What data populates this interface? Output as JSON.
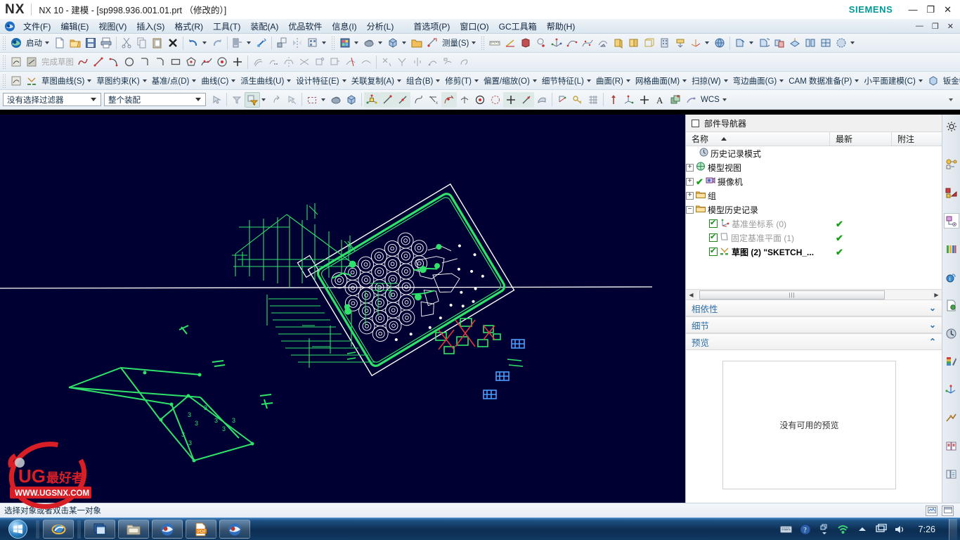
{
  "window": {
    "logo": "NX",
    "title": "NX 10 - 建模 - [sp998.936.001.01.prt （修改的）]",
    "brand": "SIEMENS",
    "minimize": "—",
    "restore": "❐",
    "close": "✕"
  },
  "menubar": {
    "items": [
      {
        "label": "文件(F)",
        "name": "menu-file"
      },
      {
        "label": "编辑(E)",
        "name": "menu-edit"
      },
      {
        "label": "视图(V)",
        "name": "menu-view"
      },
      {
        "label": "插入(S)",
        "name": "menu-insert"
      },
      {
        "label": "格式(R)",
        "name": "menu-format"
      },
      {
        "label": "工具(T)",
        "name": "menu-tools"
      },
      {
        "label": "装配(A)",
        "name": "menu-assemblies"
      },
      {
        "label": "优品软件",
        "name": "menu-youpin"
      },
      {
        "label": "信息(I)",
        "name": "menu-information"
      },
      {
        "label": "分析(L)",
        "name": "menu-analysis"
      },
      {
        "label": "首选项(P)",
        "name": "menu-preferences"
      },
      {
        "label": "窗口(O)",
        "name": "menu-window"
      },
      {
        "label": "GC工具箱",
        "name": "menu-gc-toolkits"
      },
      {
        "label": "帮助(H)",
        "name": "menu-help"
      }
    ]
  },
  "toolbar_standard": {
    "start_label": "启动",
    "measure_label": "测量(S)",
    "buttons": [
      "new-icon",
      "open-icon",
      "save-icon",
      "print-icon",
      "cut-icon",
      "copy-icon",
      "paste-icon",
      "delete-icon",
      "undo-icon",
      "redo-icon",
      "model-tree-icon",
      "link-icon",
      "transform-icon",
      "mirror-icon",
      "pattern-icon"
    ]
  },
  "toolbar_sketch": {
    "finish_sketch_label": "完成草图",
    "tools": [
      "sketch-in-task-icon",
      "sketch-on-plane-icon",
      "profile-icon",
      "line-icon",
      "arc-icon",
      "circle-icon",
      "fillet-icon",
      "chamfer-icon",
      "rectangle-icon",
      "polygon-icon",
      "studio-spline-icon",
      "ellipse-icon",
      "point-icon",
      "offset-curve-icon",
      "pattern-curve-icon",
      "mirror-curve-icon",
      "intersection-point-icon",
      "derived-lines-icon",
      "project-curve-icon",
      "quick-trim-icon",
      "quick-extend-icon",
      "constraint-icon",
      "auto-dimension-icon",
      "make-symmetric-icon",
      "animate-dimension-icon",
      "display-constraints-icon",
      "relation-browser-icon"
    ]
  },
  "toolbar_feature": {
    "groups": [
      {
        "label": "草图曲线(S)",
        "name": "group-sketch-curve"
      },
      {
        "label": "草图约束(K)",
        "name": "group-sketch-constraint"
      },
      {
        "label": "基准/点(D)",
        "name": "group-datum-point"
      },
      {
        "label": "曲线(C)",
        "name": "group-curve"
      },
      {
        "label": "派生曲线(U)",
        "name": "group-derived-curve"
      },
      {
        "label": "设计特征(E)",
        "name": "group-design-feature"
      },
      {
        "label": "关联复制(A)",
        "name": "group-associative-copy"
      },
      {
        "label": "组合(B)",
        "name": "group-combine"
      },
      {
        "label": "修剪(T)",
        "name": "group-trim"
      },
      {
        "label": "偏置/缩放(O)",
        "name": "group-offset-scale"
      },
      {
        "label": "细节特征(L)",
        "name": "group-detail-feature"
      },
      {
        "label": "曲面(R)",
        "name": "group-surface"
      },
      {
        "label": "网格曲面(M)",
        "name": "group-mesh-surface"
      },
      {
        "label": "扫掠(W)",
        "name": "group-sweep"
      },
      {
        "label": "弯边曲面(G)",
        "name": "group-flange-surface"
      },
      {
        "label": "CAM 数据准备(P)",
        "name": "group-cam-data-prep"
      },
      {
        "label": "小平面建模(C)",
        "name": "group-facet-modeling"
      },
      {
        "label": "钣金特征(H)",
        "name": "group-sheet-metal-feature"
      }
    ],
    "overflow": "»"
  },
  "selection_bar": {
    "filter_value": "没有选择过滤器",
    "scope_value": "整个装配",
    "wcs_label": "WCS",
    "icons": [
      "select-general-icon",
      "filter-icon",
      "selection-priority-icon",
      "move-object-icon",
      "deselect-icon",
      "rectangle-select-icon",
      "shaded-icon",
      "box-icon",
      "datum-csys-icon",
      "line-icon",
      "arc-icon",
      "spline-icon",
      "dimension-icon",
      "curve-icon",
      "point-icon",
      "circle-center-icon",
      "quadrant-icon",
      "intersection-icon",
      "tangent-icon",
      "face-icon",
      "wcs-dynamics-icon",
      "key-icon",
      "grid-icon",
      "vector-icon",
      "csys-icon",
      "plus-icon",
      "text-icon",
      "layer-icon",
      "wcs-icon"
    ]
  },
  "navigator": {
    "panel_title": "部件导航器",
    "columns": {
      "name": "名称",
      "newest": "最新",
      "note": "附注"
    },
    "rows": [
      {
        "label": "历史记录模式",
        "icon": "clock-icon",
        "indent": 1,
        "expander": "",
        "check": false,
        "newest": "",
        "dim": false,
        "bold": false
      },
      {
        "label": "模型视图",
        "icon": "model-views-icon",
        "indent": 0,
        "expander": "+",
        "check": false,
        "newest": "",
        "dim": false,
        "bold": false
      },
      {
        "label": "摄像机",
        "icon": "camera-icon",
        "indent": 0,
        "expander": "+",
        "check": false,
        "newest": "",
        "dim": false,
        "bold": false,
        "pretick": true
      },
      {
        "label": "组",
        "icon": "folder-icon",
        "indent": 0,
        "expander": "+",
        "check": false,
        "newest": "",
        "dim": false,
        "bold": false
      },
      {
        "label": "模型历史记录",
        "icon": "folder-icon",
        "indent": 0,
        "expander": "−",
        "check": false,
        "newest": "",
        "dim": false,
        "bold": false
      },
      {
        "label": "基准坐标系 (0)",
        "icon": "datum-csys-icon",
        "indent": 2,
        "expander": "",
        "check": true,
        "newest": "✔",
        "dim": true,
        "bold": false
      },
      {
        "label": "固定基准平面 (1)",
        "icon": "datum-plane-icon",
        "indent": 2,
        "expander": "",
        "check": true,
        "newest": "✔",
        "dim": true,
        "bold": false
      },
      {
        "label": "草图 (2) \"SKETCH_...",
        "icon": "sketch-icon",
        "indent": 2,
        "expander": "",
        "check": true,
        "newest": "✔",
        "dim": false,
        "bold": true
      }
    ],
    "sections": [
      {
        "label": "相依性",
        "name": "section-dependencies",
        "state": "collapsed",
        "chevron": "⌄"
      },
      {
        "label": "细节",
        "name": "section-details",
        "state": "collapsed",
        "chevron": "⌄"
      },
      {
        "label": "预览",
        "name": "section-preview",
        "state": "expanded",
        "chevron": "⌃"
      }
    ],
    "preview_empty_text": "没有可用的预览",
    "scroll_thumb_grip": "|||"
  },
  "resource_bar": {
    "items": [
      "assembly-navigator-icon",
      "constraint-navigator-icon",
      "part-navigator-icon",
      "reuse-library-icon",
      "web-browser-icon",
      "history-file-icon",
      "history-icon",
      "role-icon",
      "system-scene-icon",
      "process-studio-icon",
      "hd3d-tools-icon",
      "layer-navigator-icon"
    ],
    "selected_index": 2,
    "top_icon": "gear-icon"
  },
  "statusbar": {
    "message": "选择对象或者双击某一对象",
    "icons": [
      "display-icon",
      "window-icon"
    ]
  },
  "taskbar": {
    "start": "start-orb",
    "items": [
      "ie-icon",
      "explorer-icon",
      "nx-icon",
      "pdf-icon",
      "nx-icon-2"
    ],
    "tray": [
      "keyboard-icon",
      "help-icon",
      "show-hidden-icon",
      "network-icon",
      "up-arrow-icon",
      "display-icon",
      "volume-icon"
    ],
    "clock": "7:26"
  },
  "watermark": {
    "line1": "UG",
    "line2": "最好者",
    "url": "WWW.UGSNX.COM"
  }
}
